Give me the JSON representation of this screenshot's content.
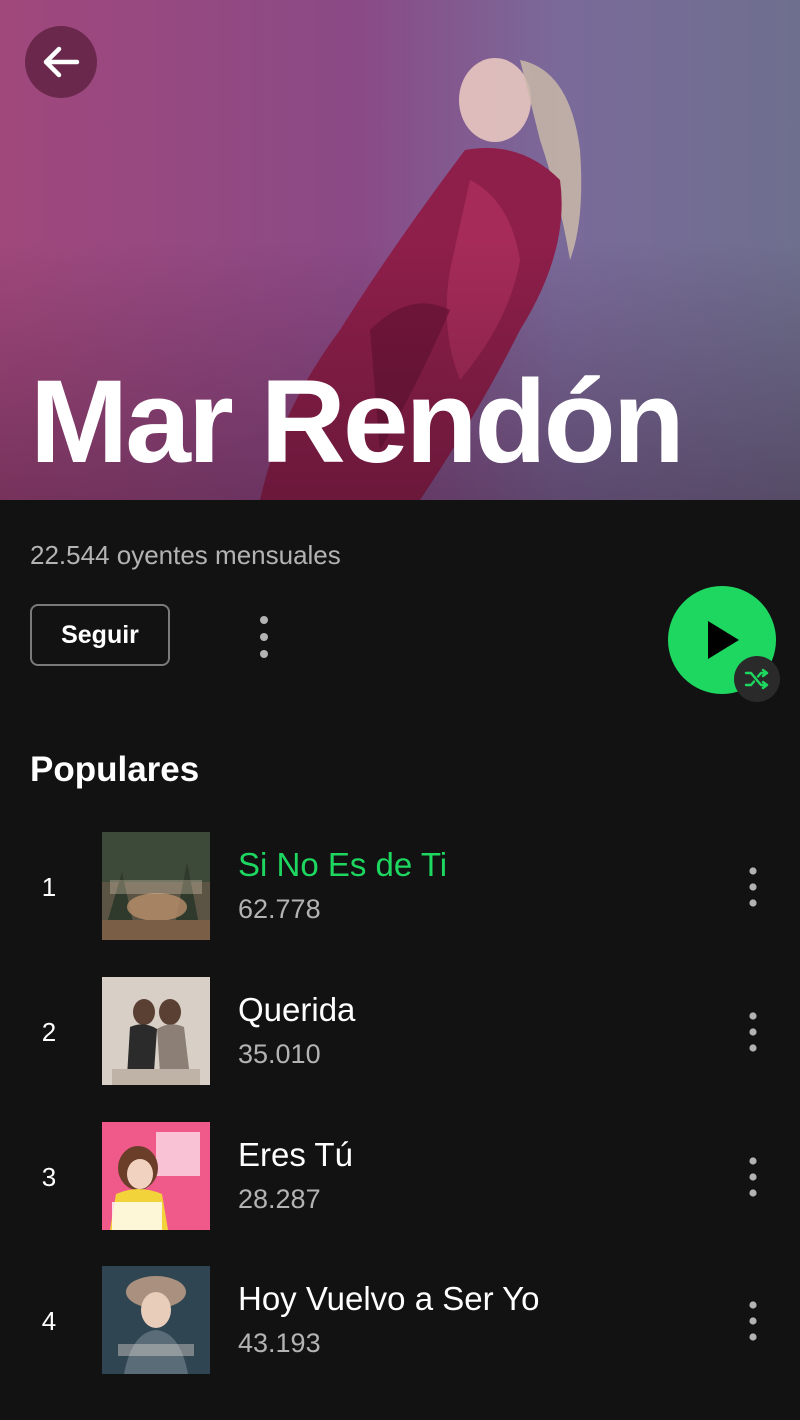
{
  "artist": {
    "name": "Mar Rendón",
    "listeners": "22.544 oyentes mensuales"
  },
  "actions": {
    "follow_label": "Seguir"
  },
  "popular": {
    "title": "Populares",
    "tracks": [
      {
        "rank": "1",
        "title": "Si No Es de Ti",
        "plays": "62.778",
        "playing": true
      },
      {
        "rank": "2",
        "title": "Querida",
        "plays": "35.010",
        "playing": false
      },
      {
        "rank": "3",
        "title": "Eres Tú",
        "plays": "28.287",
        "playing": false
      },
      {
        "rank": "4",
        "title": "Hoy Vuelvo a Ser Yo",
        "plays": "43.193",
        "playing": false
      }
    ]
  },
  "colors": {
    "accent": "#1ed760",
    "background": "#121212",
    "secondary_text": "#b3b3b3"
  },
  "icons": {
    "back": "arrow-left-icon",
    "more": "vertical-dots-icon",
    "play": "play-icon",
    "shuffle": "shuffle-icon"
  }
}
